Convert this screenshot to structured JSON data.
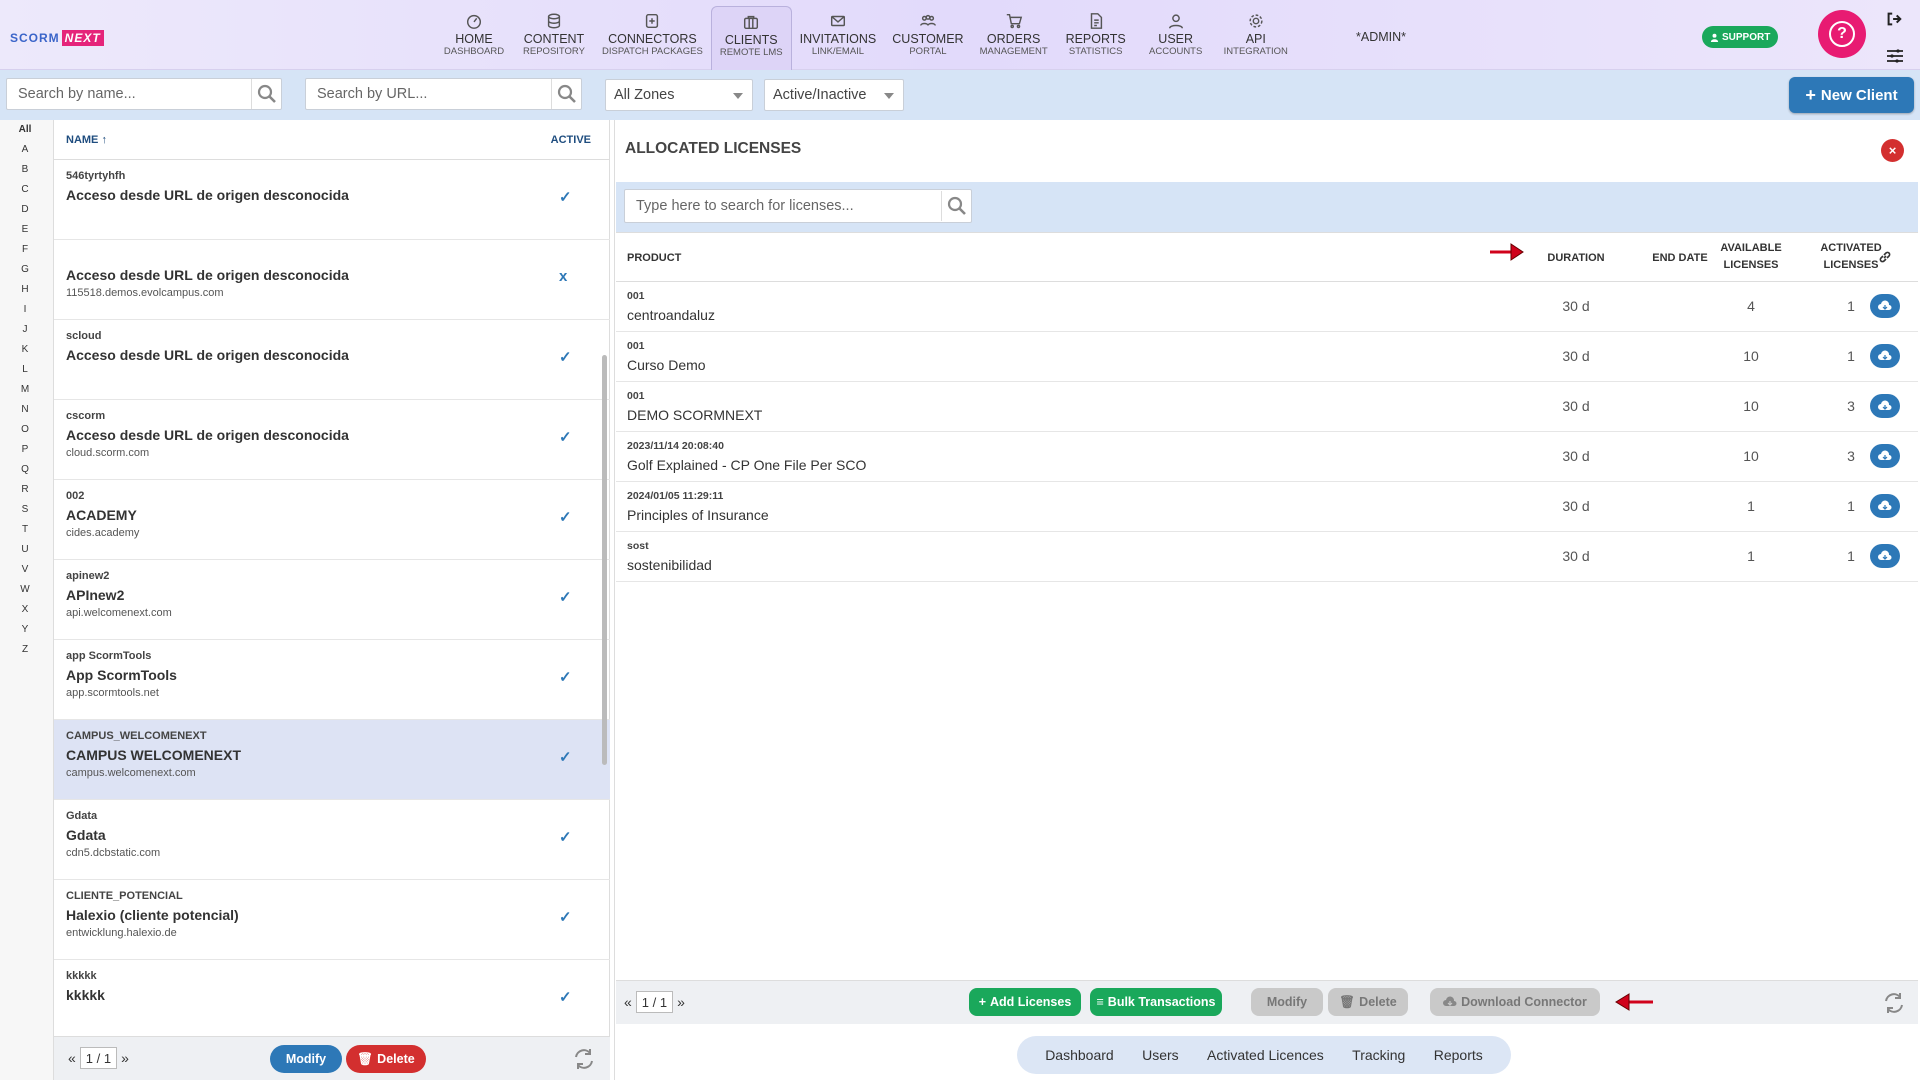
{
  "brand": {
    "part1": "SCORM",
    "part2": "NEXT"
  },
  "nav": [
    {
      "main": "HOME",
      "sub": "DASHBOARD",
      "icon": "dashboard-icon"
    },
    {
      "main": "CONTENT",
      "sub": "REPOSITORY",
      "icon": "database-icon"
    },
    {
      "main": "CONNECTORS",
      "sub": "DISPATCH PACKAGES",
      "icon": "connector-icon"
    },
    {
      "main": "CLIENTS",
      "sub": "REMOTE LMS",
      "icon": "briefcase-icon"
    },
    {
      "main": "INVITATIONS",
      "sub": "LINK/EMAIL",
      "icon": "envelope-icon"
    },
    {
      "main": "CUSTOMER",
      "sub": "PORTAL",
      "icon": "users-icon"
    },
    {
      "main": "ORDERS",
      "sub": "MANAGEMENT",
      "icon": "cart-icon"
    },
    {
      "main": "REPORTS",
      "sub": "STATISTICS",
      "icon": "document-icon"
    },
    {
      "main": "USER",
      "sub": "ACCOUNTS",
      "icon": "user-icon"
    },
    {
      "main": "API",
      "sub": "INTEGRATION",
      "icon": "gear-icon"
    }
  ],
  "admin_label": "*ADMIN*",
  "support_label": "SUPPORT",
  "help_label": "?",
  "filters": {
    "search_name_placeholder": "Search by name...",
    "search_url_placeholder": "Search by URL...",
    "zone_value": "All Zones",
    "status_value": "Active/Inactive",
    "new_client_label": "New Client"
  },
  "alphabet": [
    "All",
    "A",
    "B",
    "C",
    "D",
    "E",
    "F",
    "G",
    "H",
    "I",
    "J",
    "K",
    "L",
    "M",
    "N",
    "O",
    "P",
    "Q",
    "R",
    "S",
    "T",
    "U",
    "V",
    "W",
    "X",
    "Y",
    "Z"
  ],
  "client_list": {
    "col_name": "NAME",
    "col_active": "ACTIVE",
    "rows": [
      {
        "code": "546tyrtyhfh",
        "name": "Acceso desde URL de origen desconocida",
        "url": "",
        "active": "✓"
      },
      {
        "code": "",
        "name": "Acceso desde URL de origen desconocida",
        "url": "115518.demos.evolcampus.com",
        "active": "x"
      },
      {
        "code": "scloud",
        "name": "Acceso desde URL de origen desconocida",
        "url": "",
        "active": "✓"
      },
      {
        "code": "cscorm",
        "name": "Acceso desde URL de origen desconocida",
        "url": "cloud.scorm.com",
        "active": "✓"
      },
      {
        "code": "002",
        "name": "ACADEMY",
        "url": "cides.academy",
        "active": "✓"
      },
      {
        "code": "apinew2",
        "name": "APInew2",
        "url": "api.welcomenext.com",
        "active": "✓"
      },
      {
        "code": "app ScormTools",
        "name": "App ScormTools",
        "url": "app.scormtools.net",
        "active": "✓"
      },
      {
        "code": "CAMPUS_WELCOMENEXT",
        "name": "CAMPUS WELCOMENEXT",
        "url": "campus.welcomenext.com",
        "active": "✓"
      },
      {
        "code": "Gdata",
        "name": "Gdata",
        "url": "cdn5.dcbstatic.com",
        "active": "✓"
      },
      {
        "code": "CLIENTE_POTENCIAL",
        "name": "Halexio (cliente potencial)",
        "url": "entwicklung.halexio.de",
        "active": "✓"
      },
      {
        "code": "kkkkk",
        "name": "kkkkk",
        "url": "",
        "active": "✓"
      }
    ],
    "pager": "1 / 1",
    "modify_label": "Modify",
    "delete_label": "Delete"
  },
  "licenses": {
    "title": "ALLOCATED LICENSES",
    "close_label": "×",
    "search_placeholder": "Type here to search for licenses...",
    "headers": {
      "product": "PRODUCT",
      "duration": "DURATION",
      "end_date": "END DATE",
      "available1": "AVAILABLE",
      "available2": "LICENSES",
      "activated1": "ACTIVATED",
      "activated2": "LICENSES"
    },
    "rows": [
      {
        "code": "001",
        "name": "centroandaluz",
        "duration": "30 d",
        "available": "4",
        "activated": "1"
      },
      {
        "code": "001",
        "name": "Curso Demo",
        "duration": "30 d",
        "available": "10",
        "activated": "1"
      },
      {
        "code": "001",
        "name": "DEMO SCORMNEXT",
        "duration": "30 d",
        "available": "10",
        "activated": "3"
      },
      {
        "code": "2023/11/14 20:08:40",
        "name": "Golf Explained - CP One File Per SCO",
        "duration": "30 d",
        "available": "10",
        "activated": "3"
      },
      {
        "code": "2024/01/05 11:29:11",
        "name": "Principles of Insurance",
        "duration": "30 d",
        "available": "1",
        "activated": "1"
      },
      {
        "code": "sost",
        "name": "sostenibilidad",
        "duration": "30 d",
        "available": "1",
        "activated": "1"
      }
    ],
    "pager": "1 / 1",
    "add_label": "Add Licenses",
    "bulk_label": "Bulk Transactions",
    "modify_label": "Modify",
    "delete_label": "Delete",
    "download_label": "Download Connector"
  },
  "bottom_tabs": [
    "Dashboard",
    "Users",
    "Activated Licences",
    "Tracking",
    "Reports"
  ],
  "colors": {
    "accent": "#2d78b7",
    "support": "#1aa85b",
    "help": "#e81b72",
    "danger": "#d32f2f",
    "arrow": "#d0021b"
  }
}
